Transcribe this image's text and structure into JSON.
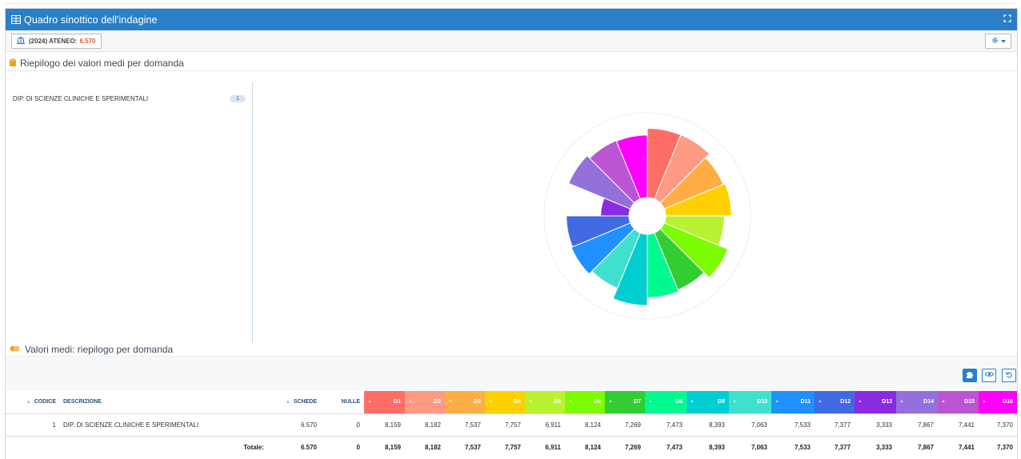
{
  "panel": {
    "title": "Quadro sinottico dell'indagine",
    "ateneo_label": "(2024) ATENEO:",
    "ateneo_value": "6.570"
  },
  "section1": {
    "title": "Riepilogo dei valori medi per domanda"
  },
  "section2": {
    "title": "Valori medi: riepilogo per domanda"
  },
  "dept_list": [
    {
      "label": "DIP. DI SCIENZE CLINICHE E SPERIMENTALI",
      "count": "1"
    }
  ],
  "chart_data": {
    "type": "pie",
    "variant": "polar-area",
    "categories": [
      "D1",
      "D3",
      "D3",
      "D4",
      "D5",
      "D6",
      "D7",
      "D8",
      "D9",
      "D10",
      "D11",
      "D12",
      "D13",
      "D14",
      "D15",
      "D16"
    ],
    "values": [
      8.159,
      8.182,
      7.537,
      7.757,
      6.911,
      8.124,
      7.269,
      7.473,
      8.393,
      7.063,
      7.533,
      7.377,
      3.333,
      7.867,
      7.441,
      7.37
    ],
    "colors": [
      "#ff6e66",
      "#ff9a85",
      "#ffad45",
      "#ffd000",
      "#b9f232",
      "#7cfc00",
      "#32cd32",
      "#00fa8f",
      "#00ced1",
      "#40e0d0",
      "#1e90ff",
      "#4169e1",
      "#8a2be2",
      "#9370db",
      "#ba55d3",
      "#ff00ff"
    ],
    "rmax": 10,
    "axis_label": "1"
  },
  "table": {
    "headers": {
      "codice": "CODICE",
      "descrizione": "DESCRIZIONE",
      "schede": "SCHEDE",
      "nulle": "NULLE"
    },
    "rows": [
      {
        "codice": "1",
        "descrizione": "DIP. DI SCIENZE CLINICHE E SPERIMENTALI",
        "schede": "6.570",
        "nulle": "0",
        "d": [
          "8,159",
          "8,182",
          "7,537",
          "7,757",
          "6,911",
          "8,124",
          "7,269",
          "7,473",
          "8,393",
          "7,063",
          "7,533",
          "7,377",
          "3,333",
          "7,867",
          "7,441",
          "7,370"
        ]
      }
    ],
    "total": {
      "label": "Totale:",
      "schede": "6.570",
      "nulle": "0",
      "d": [
        "8,159",
        "8,182",
        "7,537",
        "7,757",
        "6,911",
        "8,124",
        "7,269",
        "7,473",
        "8,393",
        "7,063",
        "7,533",
        "7,377",
        "3,333",
        "7,867",
        "7,441",
        "7,370"
      ]
    }
  }
}
